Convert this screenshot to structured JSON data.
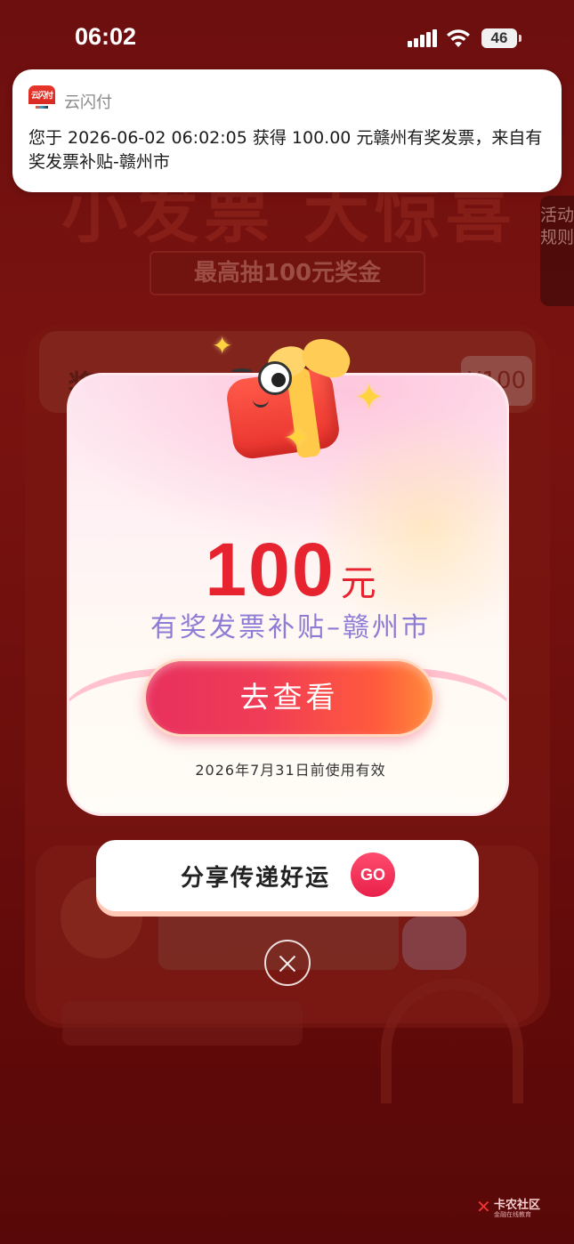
{
  "status_bar": {
    "time": "06:02",
    "battery": "46"
  },
  "background": {
    "title": "小发票 大惊喜",
    "subtitle": "最高抽100元奖金",
    "rules_label": "活动规则",
    "prize_label": "奖",
    "prize_chip": "¥100"
  },
  "notification": {
    "app_name": "云闪付",
    "icon_text": "云闪付",
    "body": "您于 2026-06-02 06:02:05 获得 100.00 元赣州有奖发票，来自有奖发票补贴-赣州市"
  },
  "reward_modal": {
    "amount": "100",
    "unit": "元",
    "subsidy_name": "有奖发票补贴–赣州市",
    "cta_label": "去查看",
    "validity": "2026年7月31日前使用有效"
  },
  "share": {
    "label": "分享传递好运",
    "go_label": "GO"
  },
  "watermark": {
    "title": "卡农社区",
    "subtitle": "金融在线教育"
  },
  "colors": {
    "accent_red": "#e6232e",
    "subsidy_purple": "#8d7cd6",
    "background_red": "#7a1414"
  }
}
